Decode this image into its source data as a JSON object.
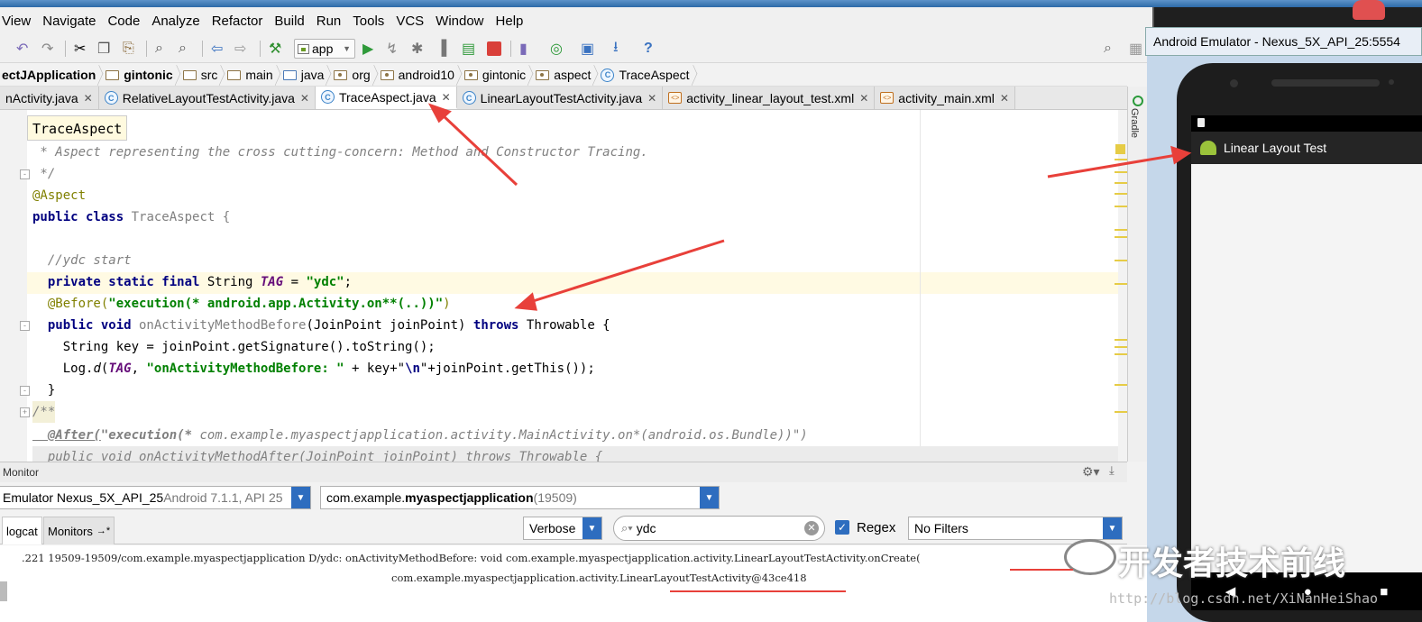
{
  "menu": [
    "View",
    "Navigate",
    "Code",
    "Analyze",
    "Refactor",
    "Build",
    "Run",
    "Tools",
    "VCS",
    "Window",
    "Help"
  ],
  "toolbar": {
    "run_config": "app"
  },
  "breadcrumb": [
    "ectJApplication",
    "gintonic",
    "src",
    "main",
    "java",
    "org",
    "android10",
    "gintonic",
    "aspect",
    "TraceAspect"
  ],
  "tabs": [
    {
      "label": "nActivity.java",
      "icon": "C",
      "active": false
    },
    {
      "label": "RelativeLayoutTestActivity.java",
      "icon": "C",
      "active": false
    },
    {
      "label": "TraceAspect.java",
      "icon": "C",
      "active": true
    },
    {
      "label": "LinearLayoutTestActivity.java",
      "icon": "C",
      "active": false
    },
    {
      "label": "activity_linear_layout_test.xml",
      "icon": "xml",
      "active": false
    },
    {
      "label": "activity_main.xml",
      "icon": "xml",
      "active": false
    }
  ],
  "tooltip": "TraceAspect",
  "side_tool": "Gradle",
  "code": {
    "l1": " * Aspect representing the cross cutting-concern: Method and Constructor Tracing.",
    "l2": " */",
    "l3": "@Aspect",
    "l4_kw": "public class",
    "l4_rest": " TraceAspect {",
    "l5": "  //ydc start",
    "l6_kw": "  private static final",
    "l6_type": " String ",
    "l6_field": "TAG",
    "l6_eq": " = ",
    "l6_str": "\"ydc\"",
    "l6_end": ";",
    "l7_ann": "  @Before(",
    "l7_str": "\"execution(* android.app.Activity.on**(..))\"",
    "l7_end": ")",
    "l8_kw": "  public void",
    "l8_name": " onActivityMethodBefore",
    "l8_args": "(JoinPoint joinPoint) ",
    "l8_kw2": "throws",
    "l8_end": " Throwable {",
    "l9": "    String key = joinPoint.getSignature().toString();",
    "l10_a": "    Log.",
    "l10_d": "d",
    "l10_b": "(",
    "l10_tag": "TAG",
    "l10_c": ", ",
    "l10_str": "\"onActivityMethodBefore: \"",
    "l10_e": " + key+\"",
    "l10_nl": "\\n",
    "l10_f": "\"+joinPoint.getThis());",
    "l11": "  }",
    "l12": "/**",
    "l13_ann": "  @After(",
    "l13_str": "\"execution(* ",
    "l13_rest": "com.example.myaspectjapplication.activity.MainActivity.on*(android.os.Bundle))\")",
    "l14": "  public void onActivityMethodAfter(JoinPoint joinPoint) throws Throwable {"
  },
  "monitor": {
    "title": "Monitor",
    "device_name": "Emulator Nexus_5X_API_25",
    "device_detail": " Android 7.1.1, API 25",
    "process_name": "com.example.",
    "process_bold": "myaspectjapplication",
    "process_pid": " (19509)",
    "tab_logcat": "logcat",
    "tab_monitors": "Monitors",
    "tab_monitors_suffix": "→*",
    "log_level": "Verbose",
    "search": "ydc",
    "regex_label": "Regex",
    "filter": "No Filters",
    "log_line1": ".221 19509-19509/com.example.myaspectjapplication D/ydc: onActivityMethodBefore: void com.example.myaspectjapplication.activity.LinearLayoutTestActivity.onCreate(",
    "log_line2": "com.example.myaspectjapplication.activity.LinearLayoutTestActivity@43ce418"
  },
  "emulator": {
    "title": "Android Emulator - Nexus_5X_API_25:5554",
    "app_title": "Linear Layout Test"
  },
  "watermark": {
    "text": "开发者技术前线",
    "url": "http://blog.csdn.net/XiNanHeiShao"
  },
  "colors": {
    "arrow": "#e8403a",
    "accent": "#2e6dbf",
    "keyword": "#000080",
    "string": "#008000",
    "comment": "#808080"
  }
}
